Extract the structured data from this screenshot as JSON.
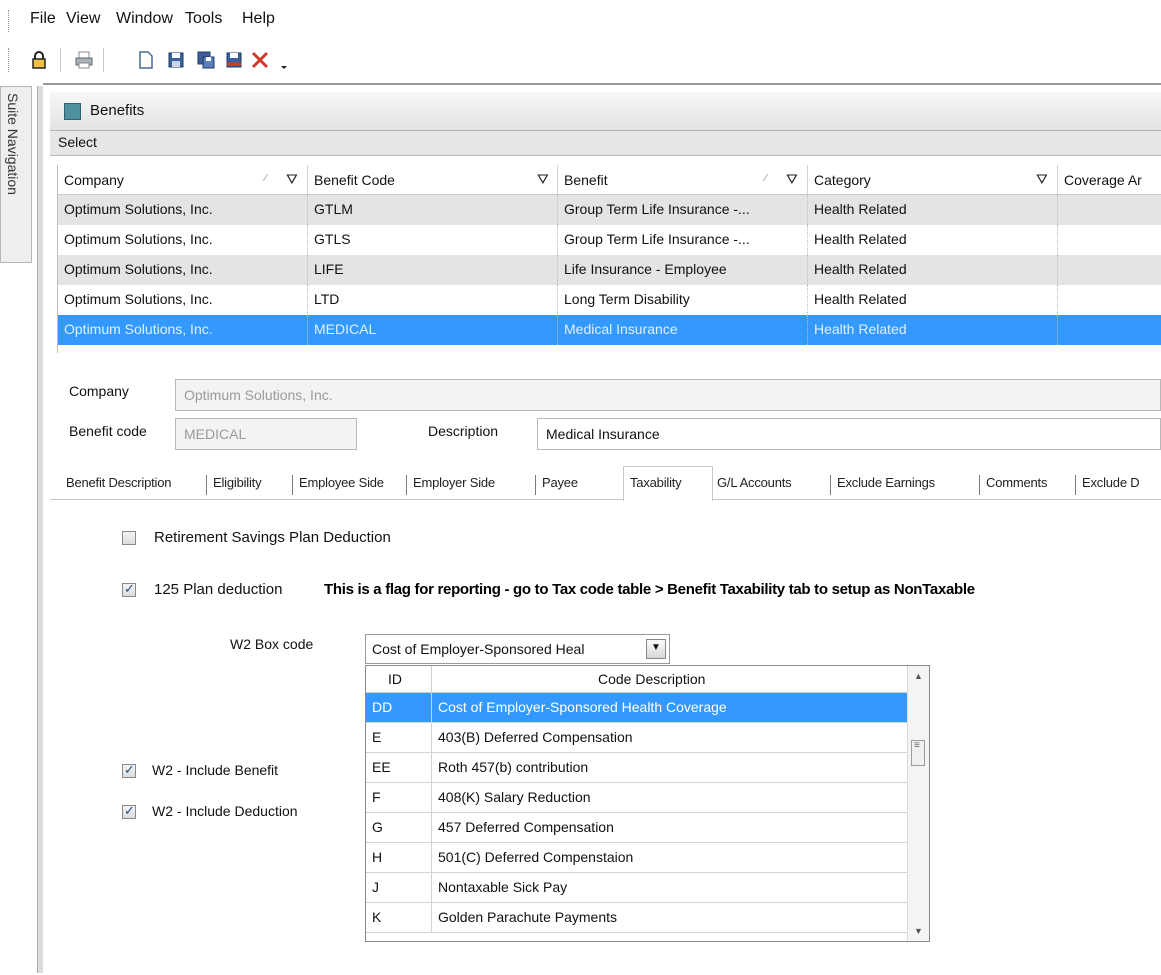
{
  "menubar": {
    "items": [
      "File",
      "View",
      "Window",
      "Tools",
      "Help"
    ]
  },
  "toolbar": {
    "icons": [
      "lock-icon",
      "print-icon",
      "new-document-icon",
      "save-icon",
      "save-as-icon",
      "save-close-icon",
      "delete-icon",
      "overflow-icon"
    ]
  },
  "suite_nav": {
    "label": "Suite Navigation"
  },
  "window": {
    "title": "Benefits"
  },
  "select_bar": {
    "label": "Select"
  },
  "grid": {
    "columns": [
      "Company",
      "Benefit Code",
      "Benefit",
      "Category",
      "Coverage Ar"
    ],
    "rows": [
      [
        "Optimum Solutions, Inc.",
        "GTLM",
        "Group Term Life Insurance -...",
        "Health Related",
        ""
      ],
      [
        "Optimum Solutions, Inc.",
        "GTLS",
        "Group Term Life Insurance -...",
        "Health Related",
        ""
      ],
      [
        "Optimum Solutions, Inc.",
        "LIFE",
        "Life Insurance - Employee",
        "Health Related",
        ""
      ],
      [
        "Optimum Solutions, Inc.",
        "LTD",
        "Long Term Disability",
        "Health Related",
        ""
      ],
      [
        "Optimum Solutions, Inc.",
        "MEDICAL",
        "Medical Insurance",
        "Health Related",
        ""
      ]
    ],
    "selected_row": 4
  },
  "form": {
    "company_label": "Company",
    "company_value": "Optimum Solutions, Inc.",
    "benefit_code_label": "Benefit code",
    "benefit_code_value": "MEDICAL",
    "description_label": "Description",
    "description_value": "Medical Insurance"
  },
  "tabs": {
    "items": [
      "Benefit Description",
      "Eligibility",
      "Employee Side",
      "Employer Side",
      "Payee",
      "Taxability",
      "G/L Accounts",
      "Exclude Earnings",
      "Comments",
      "Exclude D"
    ],
    "active": "Taxability"
  },
  "taxability": {
    "retirement_label": "Retirement Savings Plan Deduction",
    "retirement_checked": false,
    "plan125_label": "125 Plan deduction",
    "plan125_checked": true,
    "notice": "This is a flag for reporting - go to Tax code table > Benefit Taxability tab to setup as NonTaxable",
    "w2_box_label": "W2 Box code",
    "w2_box_value": "Cost of Employer-Sponsored Heal",
    "w2_include_benefit_label": "W2 - Include Benefit",
    "w2_include_benefit_checked": true,
    "w2_include_deduction_label": "W2 - Include Deduction",
    "w2_include_deduction_checked": true
  },
  "dropdown": {
    "columns": [
      "ID",
      "Code Description"
    ],
    "rows": [
      [
        "DD",
        "Cost of Employer-Sponsored Health Coverage"
      ],
      [
        "E",
        "403(B) Deferred Compensation"
      ],
      [
        "EE",
        "Roth 457(b) contribution"
      ],
      [
        "F",
        "408(K) Salary Reduction"
      ],
      [
        "G",
        "457 Deferred Compensation"
      ],
      [
        "H",
        "501(C) Deferred Compenstaion"
      ],
      [
        "J",
        "Nontaxable Sick Pay"
      ],
      [
        "K",
        "Golden Parachute Payments"
      ]
    ],
    "selected_row": 0
  },
  "colors": {
    "selection": "#3399ff",
    "alt_row": "#e4e4e4",
    "check_mark": "#1f4e8c"
  }
}
